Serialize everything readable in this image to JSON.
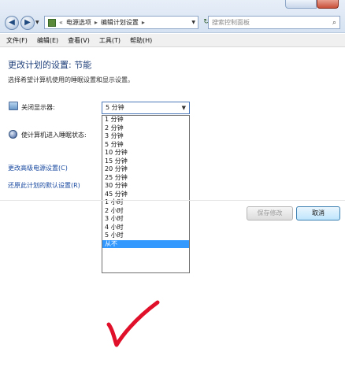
{
  "addressbar": {
    "back_glyph": "◀",
    "forward_glyph": "▶",
    "crumb_prefix": "«",
    "crumbs": [
      "电源选项",
      "编辑计划设置"
    ],
    "separator": "▸",
    "refresh_glyph": "↻",
    "search_placeholder": "搜索控制面板",
    "search_glyph": "⌕"
  },
  "menubar": {
    "items": [
      "文件(F)",
      "编辑(E)",
      "查看(V)",
      "工具(T)",
      "帮助(H)"
    ]
  },
  "page": {
    "title": "更改计划的设置: 节能",
    "subtitle": "选择希望计算机使用的睡眠设置和显示设置。",
    "display_label": "关闭显示器:",
    "sleep_label": "使计算机进入睡眠状态:",
    "display_select_value": "5 分钟",
    "dropdown_arrow": "▼",
    "options": [
      "1 分钟",
      "2 分钟",
      "3 分钟",
      "5 分钟",
      "10 分钟",
      "15 分钟",
      "20 分钟",
      "25 分钟",
      "30 分钟",
      "45 分钟",
      "1 小时",
      "2 小时",
      "3 小时",
      "4 小时",
      "5 小时",
      "从不"
    ],
    "selected_option": "从不",
    "link_advanced": "更改高级电源设置(C)",
    "link_restore": "还原此计划的默认设置(R)",
    "save_button": "保存修改",
    "cancel_button": "取消"
  },
  "colors": {
    "title": "#1e3f7a",
    "link": "#1a4aa0",
    "selection": "#3399ff",
    "check": "#e0102a"
  }
}
